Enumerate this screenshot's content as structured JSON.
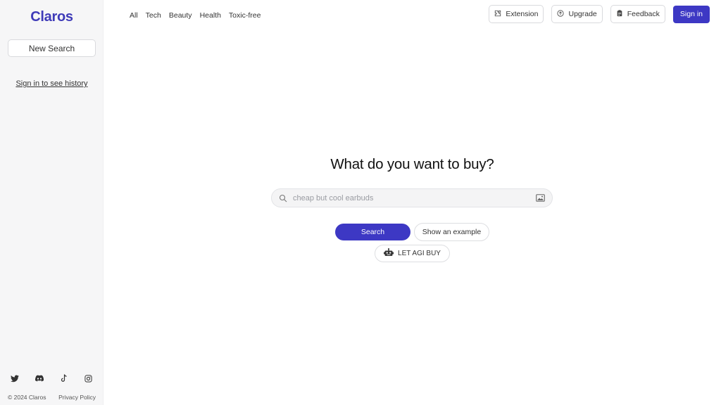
{
  "sidebar": {
    "logo": "Claros",
    "new_search_label": "New Search",
    "history_link": "Sign in to see history",
    "social_icons": [
      "twitter-icon",
      "discord-icon",
      "tiktok-icon",
      "instagram-icon"
    ],
    "footer": {
      "copyright": "© 2024 Claros",
      "privacy": "Privacy Policy"
    }
  },
  "nav": {
    "categories": [
      "All",
      "Tech",
      "Beauty",
      "Health",
      "Toxic-free"
    ]
  },
  "header": {
    "extension_label": "Extension",
    "upgrade_label": "Upgrade",
    "feedback_label": "Feedback",
    "signin_label": "Sign in"
  },
  "main": {
    "headline": "What do you want to buy?",
    "search": {
      "placeholder": "cheap but cool earbuds",
      "value": ""
    },
    "search_button": "Search",
    "example_button": "Show an example",
    "agi_button": "LET AGI BUY"
  },
  "colors": {
    "brand": "#3d38c4",
    "logo": "#3f3bb8",
    "sidebar_bg": "#f6f6f7"
  }
}
